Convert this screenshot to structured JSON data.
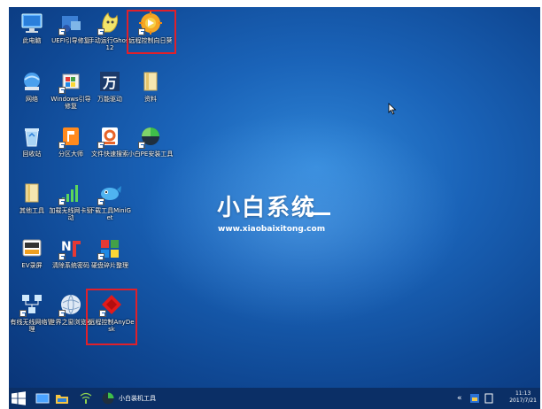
{
  "desktop": {
    "icons": [
      {
        "label": "此电脑",
        "icon": "computer-icon"
      },
      {
        "label": "UEFI引导修复",
        "icon": "uefi-repair-icon"
      },
      {
        "label": "手动运行Ghost12",
        "icon": "ghost-icon"
      },
      {
        "label": "远程控制向日葵",
        "icon": "sunflower-remote-icon"
      },
      {
        "label": "网络",
        "icon": "network-icon"
      },
      {
        "label": "Windows引导修复",
        "icon": "windows-boot-repair-icon"
      },
      {
        "label": "万能驱动",
        "icon": "wan-driver-icon"
      },
      {
        "label": "资料",
        "icon": "folder-icon"
      },
      {
        "label": "回收站",
        "icon": "recycle-bin-icon"
      },
      {
        "label": "分区大师",
        "icon": "partition-master-icon"
      },
      {
        "label": "文件快速搜索",
        "icon": "file-search-icon"
      },
      {
        "label": "小白PE安装工具",
        "icon": "pe-install-icon"
      },
      {
        "label": "其他工具",
        "icon": "tools-folder-icon"
      },
      {
        "label": "加载无线网卡驱动",
        "icon": "wireless-signal-icon"
      },
      {
        "label": "下载工具MiniGet",
        "icon": "miniget-icon"
      },
      {
        "label": "EV录屏",
        "icon": "ev-record-icon"
      },
      {
        "label": "清除系统密码",
        "icon": "clear-password-icon"
      },
      {
        "label": "硬盘碎片整理",
        "icon": "defrag-icon"
      },
      {
        "label": "有线无线网络管理",
        "icon": "net-manager-icon"
      },
      {
        "label": "世界之窗浏览器",
        "icon": "browser-globe-icon"
      },
      {
        "label": "远程控制AnyDesk",
        "icon": "anydesk-icon"
      }
    ],
    "brand_title": "小白系统",
    "brand_url": "www.xiaobaixitong.com"
  },
  "taskbar": {
    "app_label": "小白装机工具",
    "time": "11:13",
    "date": "2017/7/21",
    "tray_chevron": "«"
  },
  "colors": {
    "highlight": "#e0202a",
    "taskbar": "#0b2f66",
    "desktop": "#1a63b8"
  }
}
